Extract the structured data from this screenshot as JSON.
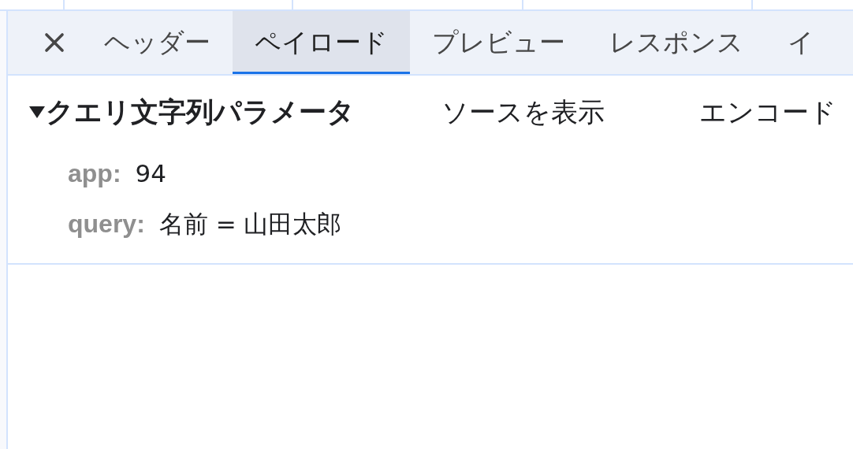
{
  "tabs": [
    {
      "label": "ヘッダー",
      "selected": false
    },
    {
      "label": "ペイロード",
      "selected": true
    },
    {
      "label": "プレビュー",
      "selected": false
    },
    {
      "label": "レスポンス",
      "selected": false
    },
    {
      "label": "イ",
      "selected": false
    }
  ],
  "section": {
    "title": "クエリ文字列パラメータ",
    "expanded": true,
    "actions": [
      "ソースを表示",
      "エンコード"
    ],
    "params": [
      {
        "key": "app:",
        "value": "94"
      },
      {
        "key": "query:",
        "value": "名前 = 山田太郎"
      }
    ]
  }
}
